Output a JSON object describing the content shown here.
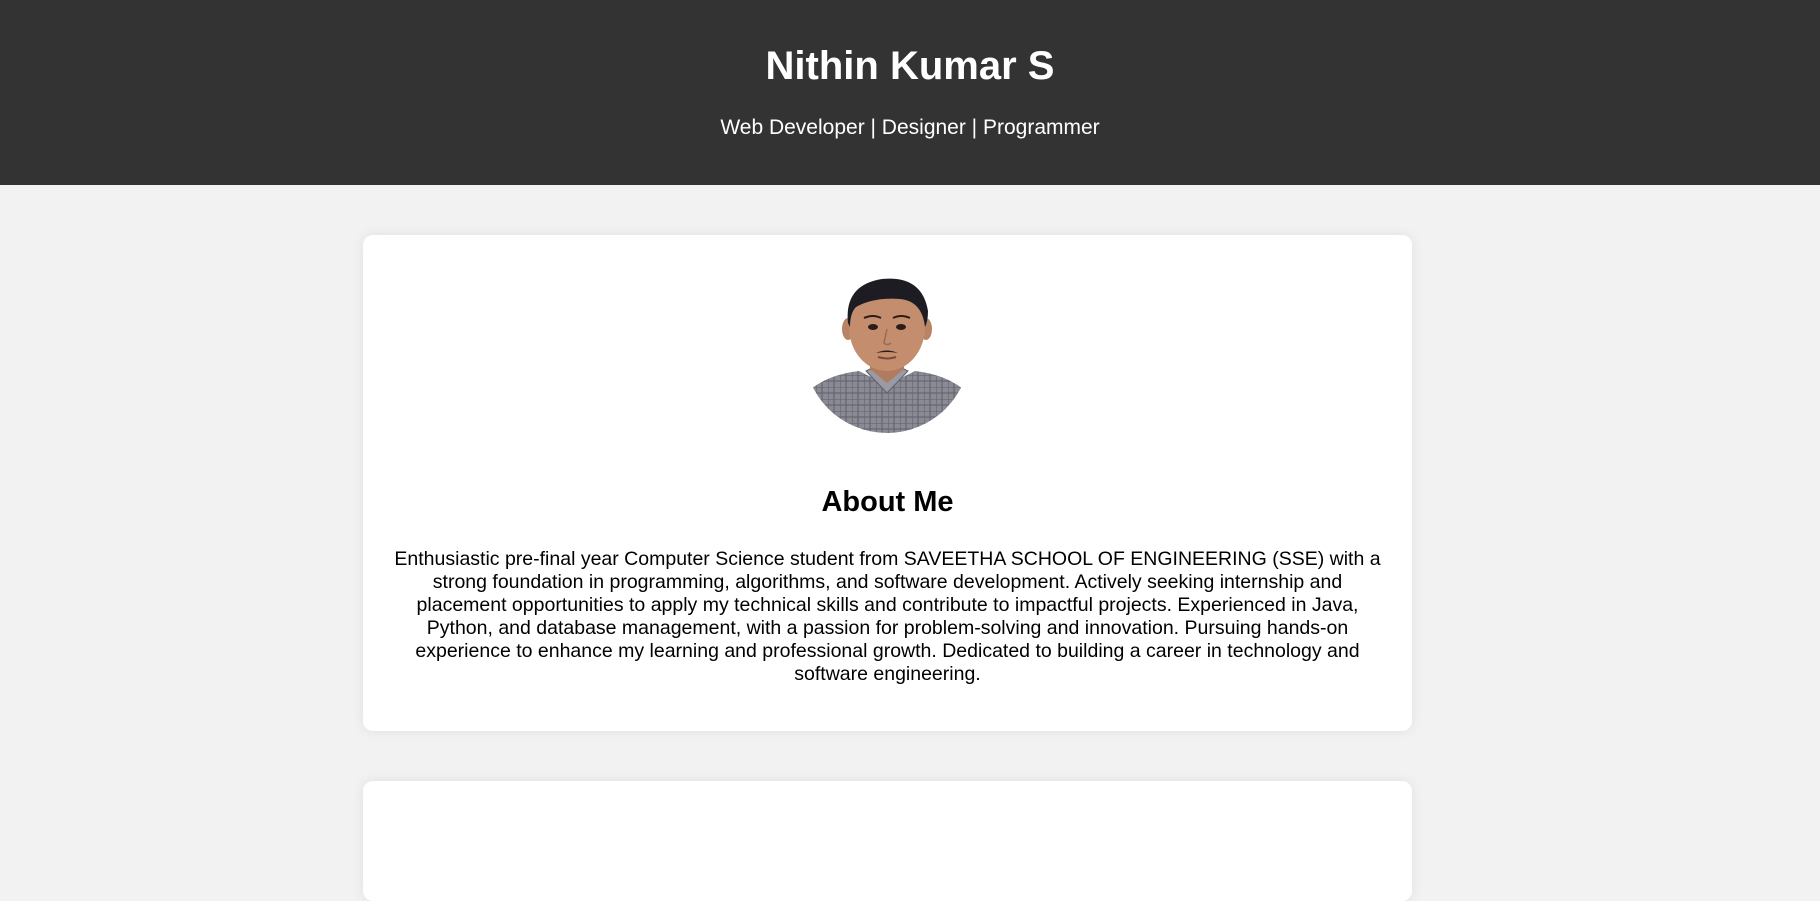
{
  "header": {
    "name": "Nithin Kumar S",
    "tagline": "Web Developer | Designer | Programmer",
    "background_color": "#333333",
    "text_color": "#ffffff"
  },
  "about": {
    "heading": "About Me",
    "bio": "Enthusiastic pre-final year Computer Science student from SAVEETHA SCHOOL OF ENGINEERING (SSE) with a strong foundation in programming, algorithms, and software development. Actively seeking internship and placement opportunities to apply my technical skills and contribute to impactful projects. Experienced in Java, Python, and database management, with a passion for problem-solving and innovation. Pursuing hands-on experience to enhance my learning and professional growth. Dedicated to building a career in technology and software engineering.",
    "photo_icon": "profile-photo"
  },
  "page": {
    "background_color": "#f2f2f2",
    "card_color": "#ffffff"
  }
}
